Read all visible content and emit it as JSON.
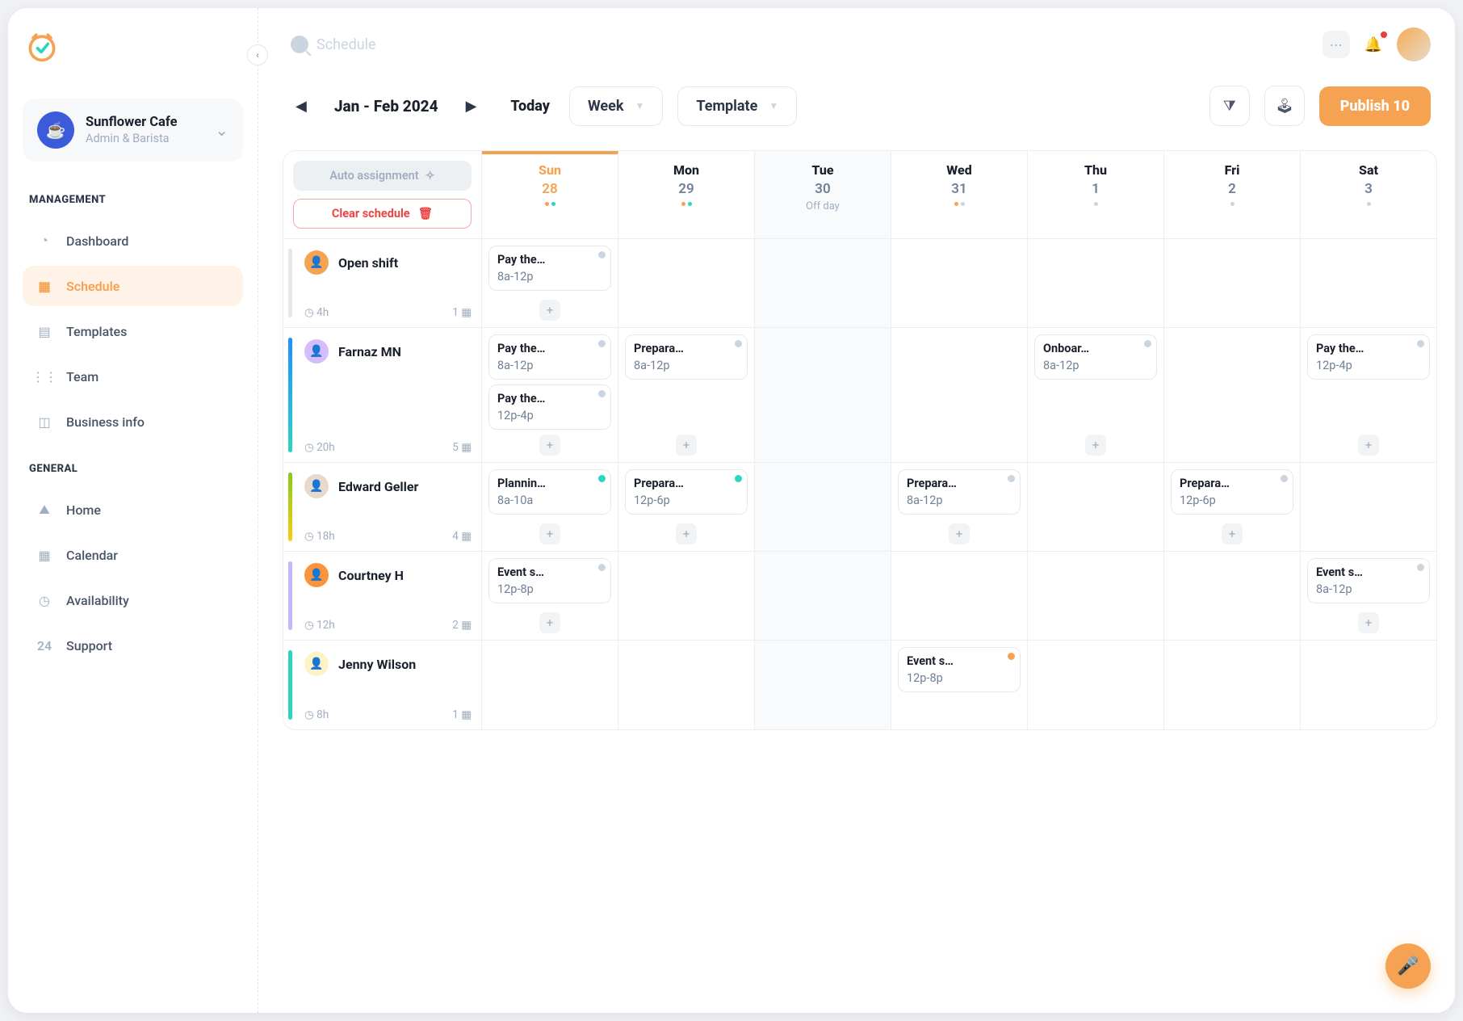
{
  "sidebar": {
    "business_name": "Sunflower Cafe",
    "business_role": "Admin & Barista",
    "sections": {
      "management_label": "MANAGEMENT",
      "general_label": "GENERAL"
    },
    "nav": {
      "dashboard": "Dashboard",
      "schedule": "Schedule",
      "templates": "Templates",
      "team": "Team",
      "business_info": "Business info",
      "home": "Home",
      "calendar": "Calendar",
      "availability": "Availability",
      "support": "Support"
    }
  },
  "topbar": {
    "search_placeholder": "Schedule"
  },
  "toolbar": {
    "date_range": "Jan - Feb 2024",
    "today": "Today",
    "view": "Week",
    "template": "Template",
    "publish": "Publish 10"
  },
  "corner": {
    "auto_label": "Auto assignment",
    "clear_label": "Clear schedule"
  },
  "days": [
    {
      "dow": "Sun",
      "num": "28",
      "dots": [
        "orange",
        "teal"
      ],
      "active": true,
      "off": false
    },
    {
      "dow": "Mon",
      "num": "29",
      "dots": [
        "orange",
        "teal"
      ],
      "active": false,
      "off": false
    },
    {
      "dow": "Tue",
      "num": "30",
      "off_label": "Off day",
      "dots": [],
      "active": false,
      "off": true
    },
    {
      "dow": "Wed",
      "num": "31",
      "dots": [
        "orange",
        "grey"
      ],
      "active": false,
      "off": false
    },
    {
      "dow": "Thu",
      "num": "1",
      "dots": [
        "grey"
      ],
      "active": false,
      "off": false
    },
    {
      "dow": "Fri",
      "num": "2",
      "dots": [
        "grey"
      ],
      "active": false,
      "off": false
    },
    {
      "dow": "Sat",
      "num": "3",
      "dots": [
        "grey"
      ],
      "active": false,
      "off": false
    }
  ],
  "rows": [
    {
      "name": "Open shift",
      "bar_color": "#e5e7eb",
      "avatar_bg": "#f5a352",
      "hours": "4h",
      "count": "1",
      "cells": [
        [
          {
            "title": "Pay the…",
            "time": "8a-12p",
            "dot": "grey"
          }
        ],
        [],
        [],
        [],
        [],
        [],
        []
      ]
    },
    {
      "name": "Farnaz MN",
      "bar_color": "linear-gradient(#1e90ff,#2dd4bf)",
      "avatar_bg": "#d6bcfa",
      "hours": "20h",
      "count": "5",
      "cells": [
        [
          {
            "title": "Pay the…",
            "time": "8a-12p",
            "dot": "grey"
          },
          {
            "title": "Pay the…",
            "time": "12p-4p",
            "dot": "grey"
          }
        ],
        [
          {
            "title": "Prepara…",
            "time": "8a-12p",
            "dot": "grey"
          }
        ],
        [],
        [],
        [
          {
            "title": "Onboar…",
            "time": "8a-12p",
            "dot": "grey"
          }
        ],
        [],
        [
          {
            "title": "Pay the…",
            "time": "12p-4p",
            "dot": "grey"
          }
        ]
      ],
      "add_visible": [
        true,
        true,
        false,
        false,
        true,
        false,
        true
      ]
    },
    {
      "name": "Edward Geller",
      "bar_color": "linear-gradient(#84cc16,#facc15)",
      "avatar_bg": "#e8d9cc",
      "hours": "18h",
      "count": "4",
      "cells": [
        [
          {
            "title": "Plannin…",
            "time": "8a-10a",
            "dot": "teal"
          }
        ],
        [
          {
            "title": "Prepara…",
            "time": "12p-6p",
            "dot": "teal"
          }
        ],
        [],
        [
          {
            "title": "Prepara…",
            "time": "8a-12p",
            "dot": "grey"
          }
        ],
        [],
        [
          {
            "title": "Prepara…",
            "time": "12p-6p",
            "dot": "grey"
          }
        ],
        []
      ],
      "add_visible": [
        true,
        true,
        false,
        true,
        false,
        true,
        false
      ]
    },
    {
      "name": "Courtney H",
      "bar_color": "#c4b5fd",
      "avatar_bg": "#fb923c",
      "hours": "12h",
      "count": "2",
      "cells": [
        [
          {
            "title": "Event s…",
            "time": "12p-8p",
            "dot": "grey"
          }
        ],
        [],
        [],
        [],
        [],
        [],
        [
          {
            "title": "Event s…",
            "time": "8a-12p",
            "dot": "grey"
          }
        ]
      ],
      "add_visible": [
        true,
        false,
        false,
        false,
        false,
        false,
        true
      ]
    },
    {
      "name": "Jenny Wilson",
      "bar_color": "#2dd4bf",
      "avatar_bg": "#fef3c7",
      "hours": "8h",
      "count": "1",
      "cells": [
        [],
        [],
        [],
        [
          {
            "title": "Event s…",
            "time": "12p-8p",
            "dot": "orange"
          }
        ],
        [],
        [],
        []
      ],
      "add_visible": [
        false,
        false,
        false,
        false,
        false,
        false,
        false
      ]
    }
  ]
}
